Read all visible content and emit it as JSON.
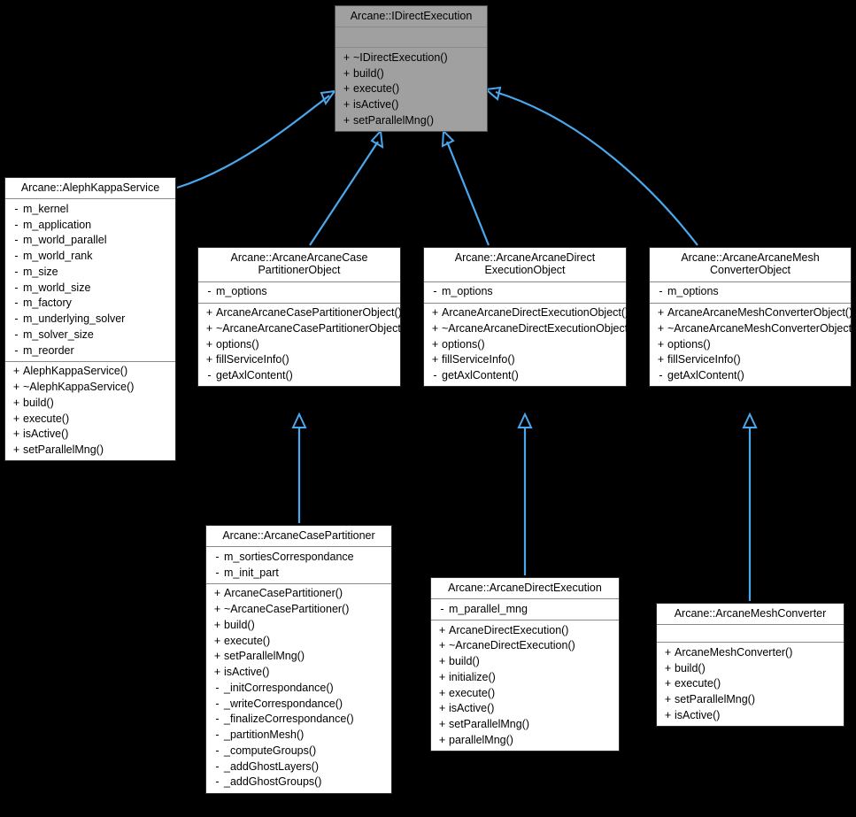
{
  "diagram": {
    "kind": "uml-class-inheritance-diagram",
    "background_color": "#000000",
    "edge_color": "#4aa8ee",
    "highlight_color": "#a0a0a0",
    "box_fill": "#ffffff",
    "box_border": "#2b2b2b"
  },
  "classes": {
    "idirectexecution": {
      "title": "Arcane::IDirectExecution",
      "highlighted": true,
      "attributes": [],
      "methods": [
        {
          "vis": "+",
          "name": "~IDirectExecution()"
        },
        {
          "vis": "+",
          "name": "build()"
        },
        {
          "vis": "+",
          "name": "execute()"
        },
        {
          "vis": "+",
          "name": "isActive()"
        },
        {
          "vis": "+",
          "name": "setParallelMng()"
        }
      ]
    },
    "alephkappaservice": {
      "title": "Arcane::AlephKappaService",
      "highlighted": false,
      "attributes": [
        {
          "vis": "-",
          "name": "m_kernel"
        },
        {
          "vis": "-",
          "name": "m_application"
        },
        {
          "vis": "-",
          "name": "m_world_parallel"
        },
        {
          "vis": "-",
          "name": "m_world_rank"
        },
        {
          "vis": "-",
          "name": "m_size"
        },
        {
          "vis": "-",
          "name": "m_world_size"
        },
        {
          "vis": "-",
          "name": "m_factory"
        },
        {
          "vis": "-",
          "name": "m_underlying_solver"
        },
        {
          "vis": "-",
          "name": "m_solver_size"
        },
        {
          "vis": "-",
          "name": "m_reorder"
        }
      ],
      "methods": [
        {
          "vis": "+",
          "name": "AlephKappaService()"
        },
        {
          "vis": "+",
          "name": "~AlephKappaService()"
        },
        {
          "vis": "+",
          "name": "build()"
        },
        {
          "vis": "+",
          "name": "execute()"
        },
        {
          "vis": "+",
          "name": "isActive()"
        },
        {
          "vis": "+",
          "name": "setParallelMng()"
        }
      ]
    },
    "casepartitionerobject": {
      "title": "Arcane::ArcaneArcaneCase\nPartitionerObject",
      "highlighted": false,
      "attributes": [
        {
          "vis": "-",
          "name": "m_options"
        }
      ],
      "methods": [
        {
          "vis": "+",
          "name": "ArcaneArcaneCasePartitionerObject()"
        },
        {
          "vis": "+",
          "name": "~ArcaneArcaneCasePartitionerObject()"
        },
        {
          "vis": "+",
          "name": "options()"
        },
        {
          "vis": "+",
          "name": "fillServiceInfo()"
        },
        {
          "vis": "-",
          "name": "getAxlContent()"
        }
      ]
    },
    "directexecutionobject": {
      "title": "Arcane::ArcaneArcaneDirect\nExecutionObject",
      "highlighted": false,
      "attributes": [
        {
          "vis": "-",
          "name": "m_options"
        }
      ],
      "methods": [
        {
          "vis": "+",
          "name": "ArcaneArcaneDirectExecutionObject()"
        },
        {
          "vis": "+",
          "name": "~ArcaneArcaneDirectExecutionObject()"
        },
        {
          "vis": "+",
          "name": "options()"
        },
        {
          "vis": "+",
          "name": "fillServiceInfo()"
        },
        {
          "vis": "-",
          "name": "getAxlContent()"
        }
      ]
    },
    "meshconverterobject": {
      "title": "Arcane::ArcaneArcaneMesh\nConverterObject",
      "highlighted": false,
      "attributes": [
        {
          "vis": "-",
          "name": "m_options"
        }
      ],
      "methods": [
        {
          "vis": "+",
          "name": "ArcaneArcaneMeshConverterObject()"
        },
        {
          "vis": "+",
          "name": "~ArcaneArcaneMeshConverterObject()"
        },
        {
          "vis": "+",
          "name": "options()"
        },
        {
          "vis": "+",
          "name": "fillServiceInfo()"
        },
        {
          "vis": "-",
          "name": "getAxlContent()"
        }
      ]
    },
    "arcanecasepartitioner": {
      "title": "Arcane::ArcaneCasePartitioner",
      "highlighted": false,
      "attributes": [
        {
          "vis": "-",
          "name": "m_sortiesCorrespondance"
        },
        {
          "vis": "-",
          "name": "m_init_part"
        }
      ],
      "methods": [
        {
          "vis": "+",
          "name": "ArcaneCasePartitioner()"
        },
        {
          "vis": "+",
          "name": "~ArcaneCasePartitioner()"
        },
        {
          "vis": "+",
          "name": "build()"
        },
        {
          "vis": "+",
          "name": "execute()"
        },
        {
          "vis": "+",
          "name": "setParallelMng()"
        },
        {
          "vis": "+",
          "name": "isActive()"
        },
        {
          "vis": "-",
          "name": "_initCorrespondance()"
        },
        {
          "vis": "-",
          "name": "_writeCorrespondance()"
        },
        {
          "vis": "-",
          "name": "_finalizeCorrespondance()"
        },
        {
          "vis": "-",
          "name": "_partitionMesh()"
        },
        {
          "vis": "-",
          "name": "_computeGroups()"
        },
        {
          "vis": "-",
          "name": "_addGhostLayers()"
        },
        {
          "vis": "-",
          "name": "_addGhostGroups()"
        }
      ]
    },
    "arcanedirectexecution": {
      "title": "Arcane::ArcaneDirectExecution",
      "highlighted": false,
      "attributes": [
        {
          "vis": "-",
          "name": "m_parallel_mng"
        }
      ],
      "methods": [
        {
          "vis": "+",
          "name": "ArcaneDirectExecution()"
        },
        {
          "vis": "+",
          "name": "~ArcaneDirectExecution()"
        },
        {
          "vis": "+",
          "name": "build()"
        },
        {
          "vis": "+",
          "name": "initialize()"
        },
        {
          "vis": "+",
          "name": "execute()"
        },
        {
          "vis": "+",
          "name": "isActive()"
        },
        {
          "vis": "+",
          "name": "setParallelMng()"
        },
        {
          "vis": "+",
          "name": "parallelMng()"
        }
      ]
    },
    "arcanemeshconverter": {
      "title": "Arcane::ArcaneMeshConverter",
      "highlighted": false,
      "attributes": [],
      "methods": [
        {
          "vis": "+",
          "name": "ArcaneMeshConverter()"
        },
        {
          "vis": "+",
          "name": "build()"
        },
        {
          "vis": "+",
          "name": "execute()"
        },
        {
          "vis": "+",
          "name": "setParallelMng()"
        },
        {
          "vis": "+",
          "name": "isActive()"
        }
      ]
    }
  },
  "edges": [
    {
      "from": "alephkappaservice",
      "to": "idirectexecution",
      "type": "inheritance"
    },
    {
      "from": "casepartitionerobject",
      "to": "idirectexecution",
      "type": "inheritance"
    },
    {
      "from": "directexecutionobject",
      "to": "idirectexecution",
      "type": "inheritance"
    },
    {
      "from": "meshconverterobject",
      "to": "idirectexecution",
      "type": "inheritance"
    },
    {
      "from": "arcanecasepartitioner",
      "to": "casepartitionerobject",
      "type": "inheritance"
    },
    {
      "from": "arcanedirectexecution",
      "to": "directexecutionobject",
      "type": "inheritance"
    },
    {
      "from": "arcanemeshconverter",
      "to": "meshconverterobject",
      "type": "inheritance"
    }
  ]
}
